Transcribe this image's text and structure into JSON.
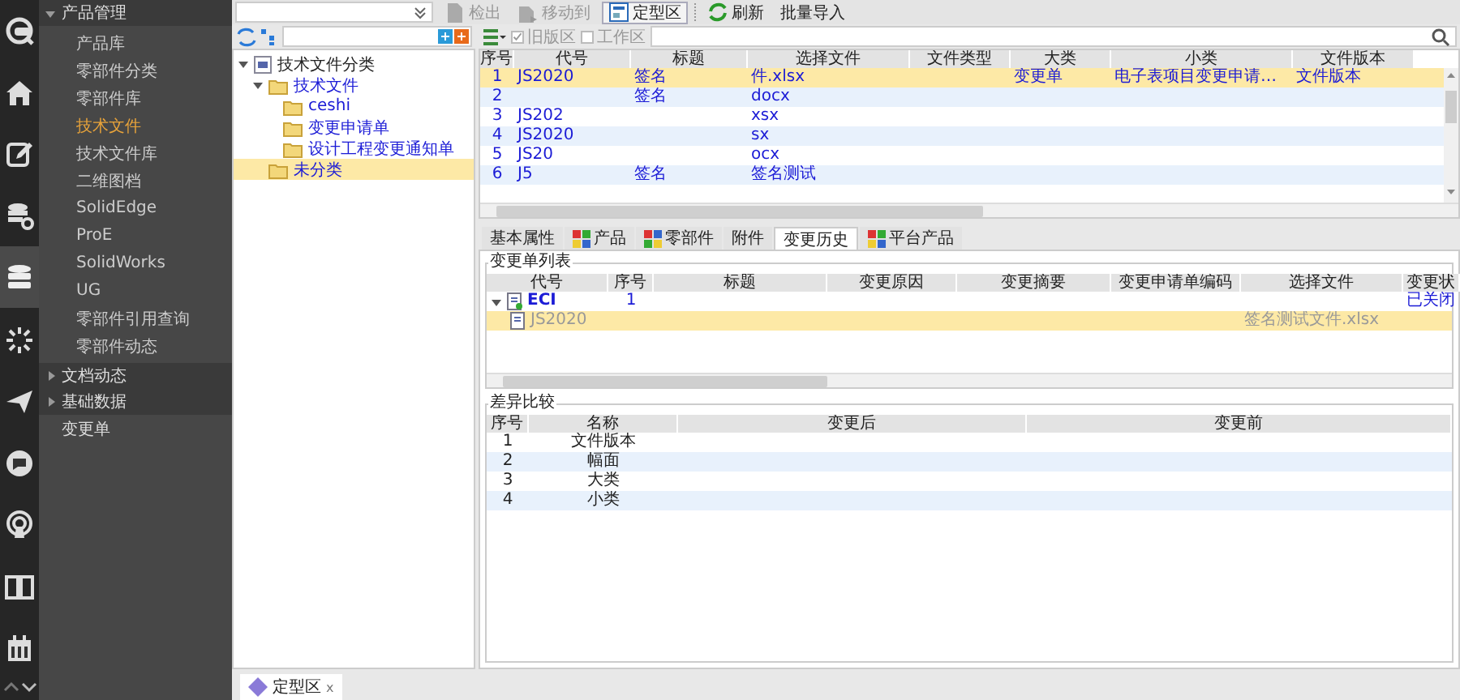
{
  "rail": [
    {
      "kind": "logo",
      "selected": false
    },
    {
      "kind": "home",
      "selected": false
    },
    {
      "kind": "edit",
      "selected": false
    },
    {
      "kind": "db-gear",
      "selected": false
    },
    {
      "kind": "db",
      "selected": true
    },
    {
      "kind": "spinner",
      "selected": false
    },
    {
      "kind": "plane",
      "selected": false
    },
    {
      "kind": "chat",
      "selected": false
    },
    {
      "kind": "broadcast",
      "selected": false
    },
    {
      "kind": "book",
      "selected": false
    },
    {
      "kind": "calendar",
      "selected": false
    }
  ],
  "nav": [
    {
      "label": "产品管理",
      "kind": "group",
      "expanded": true,
      "children": [
        {
          "label": "产品库",
          "selected": false
        },
        {
          "label": "零部件分类",
          "selected": false
        },
        {
          "label": "零部件库",
          "selected": false
        },
        {
          "label": "技术文件",
          "selected": true
        },
        {
          "label": "技术文件库",
          "selected": false
        },
        {
          "label": "二维图档",
          "selected": false
        },
        {
          "label": "SolidEdge",
          "selected": false
        },
        {
          "label": "ProE",
          "selected": false
        },
        {
          "label": "SolidWorks",
          "selected": false
        },
        {
          "label": "UG",
          "selected": false
        },
        {
          "label": "零部件引用查询",
          "selected": false
        },
        {
          "label": "零部件动态",
          "selected": false
        }
      ]
    },
    {
      "label": "文档动态",
      "kind": "group",
      "expanded": false
    },
    {
      "label": "基础数据",
      "kind": "group",
      "expanded": false
    },
    {
      "label": "变更单",
      "kind": "item"
    }
  ],
  "toolbar": [
    {
      "label": "检出",
      "kind": "doc",
      "disabled": true
    },
    {
      "label": "移动到",
      "kind": "move",
      "disabled": true
    },
    {
      "label": "定型区",
      "kind": "area",
      "disabled": false
    },
    {
      "label": "刷新",
      "kind": "refresh",
      "disabled": false
    },
    {
      "label": "批量导入",
      "kind": "none",
      "disabled": false
    }
  ],
  "tree": [
    {
      "label": "技术文件分类",
      "kind": "root",
      "expanded": true,
      "selected": false,
      "children": [
        {
          "label": "技术文件",
          "kind": "folder",
          "expanded": true,
          "selected": false,
          "children": [
            {
              "label": "ceshi",
              "kind": "folder",
              "selected": false
            },
            {
              "label": "变更申请单",
              "kind": "folder",
              "selected": false
            },
            {
              "label": "设计工程变更通知单",
              "kind": "folder",
              "selected": false
            }
          ]
        },
        {
          "label": "未分类",
          "kind": "folder",
          "selected": true
        }
      ]
    }
  ],
  "filters": [
    {
      "label": "旧版区",
      "checked": true
    },
    {
      "label": "工作区",
      "checked": false
    }
  ],
  "files_table": {
    "columns": [
      "序号",
      "代号",
      "标题",
      "选择文件",
      "文件类型",
      "大类",
      "小类",
      "文件版本"
    ],
    "rows": [
      {
        "selected": true,
        "cells": [
          "1",
          "JS2020",
          "签名",
          "件.xlsx",
          "",
          "变更单",
          "电子表项目变更申请…",
          "文件版本"
        ]
      },
      {
        "selected": false,
        "cells": [
          "2",
          "",
          "签名",
          "docx",
          "",
          "",
          "",
          ""
        ]
      },
      {
        "selected": false,
        "cells": [
          "3",
          "JS202",
          "",
          "xsx",
          "",
          "",
          "",
          ""
        ]
      },
      {
        "selected": false,
        "cells": [
          "4",
          "JS2020",
          "",
          "sx",
          "",
          "",
          "",
          ""
        ]
      },
      {
        "selected": false,
        "cells": [
          "5",
          "JS20",
          "",
          "ocx",
          "",
          "",
          "",
          ""
        ]
      },
      {
        "selected": false,
        "cells": [
          "6",
          "J5",
          "签名",
          "签名测试",
          "",
          "",
          "",
          ""
        ]
      }
    ]
  },
  "detail_tabs": [
    {
      "label": "基本属性",
      "kind": "plain",
      "selected": false
    },
    {
      "label": "产品",
      "kind": "grid",
      "selected": false
    },
    {
      "label": "零部件",
      "kind": "parts",
      "selected": false
    },
    {
      "label": "附件",
      "kind": "plain",
      "selected": false
    },
    {
      "label": "变更历史",
      "kind": "plain",
      "selected": true
    },
    {
      "label": "平台产品",
      "kind": "grid",
      "selected": false
    }
  ],
  "change_list": {
    "title": "变更单列表",
    "columns": [
      "代号",
      "序号",
      "标题",
      "变更原因",
      "变更摘要",
      "变更申请单编码",
      "选择文件",
      "变更状"
    ],
    "rows": [
      {
        "expanded": true,
        "selected": false,
        "cells": [
          "ECI",
          "1",
          "",
          "",
          "",
          "",
          "",
          "已关闭"
        ],
        "children": [
          {
            "selected": true,
            "cells": [
              "JS2020",
              "",
              "",
              "",
              "",
              "",
              "签名测试文件.xlsx",
              ""
            ]
          }
        ]
      }
    ]
  },
  "diff": {
    "title": "差异比较",
    "columns": [
      "序号",
      "名称",
      "变更后",
      "变更前"
    ],
    "rows": [
      [
        "1",
        "文件版本",
        "",
        ""
      ],
      [
        "2",
        "幅面",
        "",
        ""
      ],
      [
        "3",
        "大类",
        "",
        ""
      ],
      [
        "4",
        "小类",
        "",
        ""
      ]
    ]
  },
  "bottom_tabs": [
    {
      "label": "定型区",
      "close": "ⅹ",
      "selected": true
    }
  ]
}
